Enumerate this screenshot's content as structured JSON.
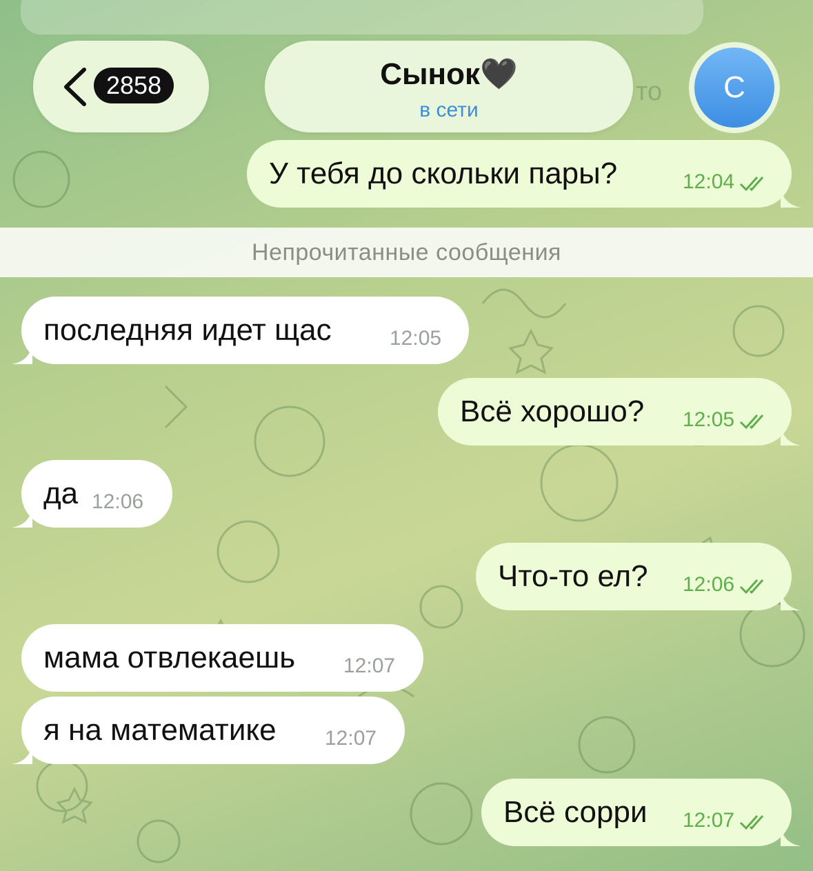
{
  "header": {
    "back_count": "2858",
    "title": "Сынок🖤",
    "status": "в сети",
    "avatar_letter": "C",
    "behind_text": "то"
  },
  "divider": {
    "label": "Непрочитанные сообщения"
  },
  "messages": [
    {
      "dir": "out",
      "text": "У тебя до скольки пары?",
      "time": "12:04"
    },
    {
      "dir": "in",
      "text": "последняя идет щас",
      "time": "12:05"
    },
    {
      "dir": "out",
      "text": "Всё хорошо?",
      "time": "12:05"
    },
    {
      "dir": "in",
      "text": "да",
      "time": "12:06"
    },
    {
      "dir": "out",
      "text": "Что-то ел?",
      "time": "12:06"
    },
    {
      "dir": "in",
      "text": "мама отвлекаешь",
      "time": "12:07"
    },
    {
      "dir": "in",
      "text": "я на математике",
      "time": "12:07"
    },
    {
      "dir": "out",
      "text": "Всё сорри",
      "time": "12:07"
    }
  ],
  "colors": {
    "incoming_bubble": "#ffffff",
    "outgoing_bubble": "#edfbd7",
    "outgoing_time": "#5eae4b",
    "online_status": "#3a8fd6",
    "badge": "#111111"
  },
  "icons": {
    "back": "chevron-left-icon",
    "read": "double-check-icon"
  }
}
